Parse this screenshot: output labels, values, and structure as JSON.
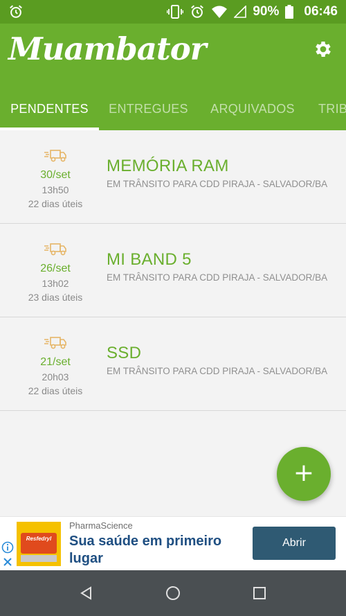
{
  "status_bar": {
    "battery_text": "90%",
    "clock": "06:46",
    "icons": [
      "alarm-icon",
      "vibrate-icon",
      "alarm-icon",
      "wifi-icon",
      "signal-icon",
      "battery-icon"
    ]
  },
  "app": {
    "title": "Muambator",
    "settings_icon": "gear-icon"
  },
  "tabs": [
    {
      "label": "PENDENTES",
      "active": true
    },
    {
      "label": "ENTREGUES",
      "active": false
    },
    {
      "label": "ARQUIVADOS",
      "active": false
    },
    {
      "label": "TRIB",
      "active": false
    }
  ],
  "packages": [
    {
      "date": "30/set",
      "time": "13h50",
      "days": "22 dias úteis",
      "title": "MEMÓRIA RAM",
      "status": "EM TRÂNSITO PARA CDD PIRAJA - SALVADOR/BA"
    },
    {
      "date": "26/set",
      "time": "13h02",
      "days": "23 dias úteis",
      "title": "MI BAND 5",
      "status": "EM TRÂNSITO PARA CDD PIRAJA - SALVADOR/BA"
    },
    {
      "date": "21/set",
      "time": "20h03",
      "days": "22 dias úteis",
      "title": "SSD",
      "status": "EM TRÂNSITO PARA CDD PIRAJA - SALVADOR/BA"
    }
  ],
  "fab": {
    "label": "+"
  },
  "ad": {
    "sponsor": "PharmaScience",
    "headline": "Sua saúde em primeiro lugar",
    "cta": "Abrir",
    "image_text": "Resfedryl"
  },
  "colors": {
    "status_bar": "#5a9c21",
    "primary": "#6aaf2e",
    "ad_cta": "#2f5a73",
    "ad_headline": "#1f4f82",
    "nav_bar": "#4a4f52"
  }
}
